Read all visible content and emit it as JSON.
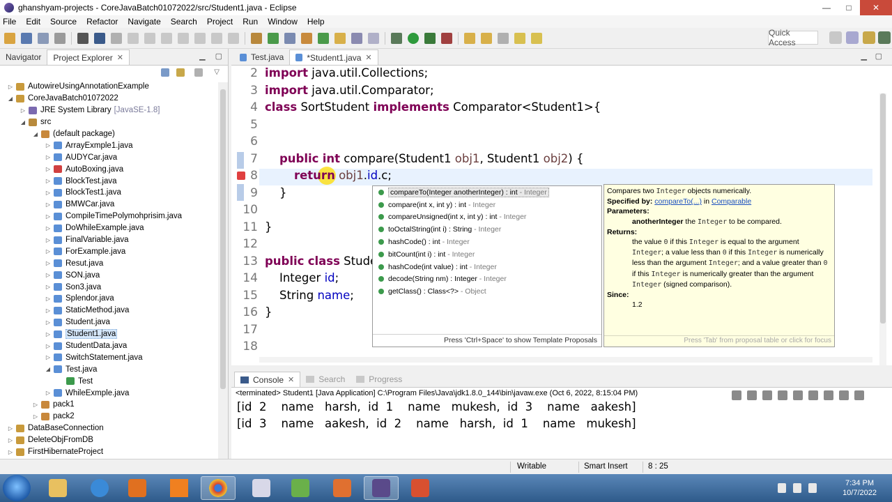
{
  "window": {
    "title": "ghanshyam-projects - CoreJavaBatch01072022/src/Student1.java - Eclipse",
    "controls": [
      "—",
      "□",
      "✕"
    ]
  },
  "menu": [
    "File",
    "Edit",
    "Source",
    "Refactor",
    "Navigate",
    "Search",
    "Project",
    "Run",
    "Window",
    "Help"
  ],
  "toolbar": {
    "quick_access": "Quick Access"
  },
  "left_tabs": [
    {
      "label": "Navigator",
      "close": ""
    },
    {
      "label": "Project Explorer",
      "close": "✕"
    }
  ],
  "tree": [
    {
      "indent": 0,
      "toggle": "▷",
      "icon": "proj",
      "label": "AutowireUsingAnnotationExample",
      "dim": ""
    },
    {
      "indent": 0,
      "toggle": "◢",
      "icon": "proj",
      "label": "CoreJavaBatch01072022",
      "dim": ""
    },
    {
      "indent": 1,
      "toggle": "▷",
      "icon": "lib",
      "label": "JRE System Library",
      "dim": "[JavaSE-1.8]"
    },
    {
      "indent": 1,
      "toggle": "◢",
      "icon": "src",
      "label": "src",
      "dim": ""
    },
    {
      "indent": 2,
      "toggle": "◢",
      "icon": "pkg",
      "label": "(default package)",
      "dim": ""
    },
    {
      "indent": 3,
      "toggle": "▷",
      "icon": "java",
      "label": "ArrayExmple1.java",
      "dim": ""
    },
    {
      "indent": 3,
      "toggle": "▷",
      "icon": "java",
      "label": "AUDYCar.java",
      "dim": ""
    },
    {
      "indent": 3,
      "toggle": "▷",
      "icon": "err",
      "label": "AutoBoxing.java",
      "dim": ""
    },
    {
      "indent": 3,
      "toggle": "▷",
      "icon": "java",
      "label": "BlockTest.java",
      "dim": ""
    },
    {
      "indent": 3,
      "toggle": "▷",
      "icon": "java",
      "label": "BlockTest1.java",
      "dim": ""
    },
    {
      "indent": 3,
      "toggle": "▷",
      "icon": "java",
      "label": "BMWCar.java",
      "dim": ""
    },
    {
      "indent": 3,
      "toggle": "▷",
      "icon": "java",
      "label": "CompileTimePolymohprisim.java",
      "dim": ""
    },
    {
      "indent": 3,
      "toggle": "▷",
      "icon": "java",
      "label": "DoWhileExample.java",
      "dim": ""
    },
    {
      "indent": 3,
      "toggle": "▷",
      "icon": "java",
      "label": "FinalVariable.java",
      "dim": ""
    },
    {
      "indent": 3,
      "toggle": "▷",
      "icon": "java",
      "label": "ForExample.java",
      "dim": ""
    },
    {
      "indent": 3,
      "toggle": "▷",
      "icon": "java",
      "label": "Resut.java",
      "dim": ""
    },
    {
      "indent": 3,
      "toggle": "▷",
      "icon": "java",
      "label": "SON.java",
      "dim": ""
    },
    {
      "indent": 3,
      "toggle": "▷",
      "icon": "java",
      "label": "Son3.java",
      "dim": ""
    },
    {
      "indent": 3,
      "toggle": "▷",
      "icon": "java",
      "label": "Splendor.java",
      "dim": ""
    },
    {
      "indent": 3,
      "toggle": "▷",
      "icon": "java",
      "label": "StaticMethod.java",
      "dim": ""
    },
    {
      "indent": 3,
      "toggle": "▷",
      "icon": "java",
      "label": "Student.java",
      "dim": ""
    },
    {
      "indent": 3,
      "toggle": "▷",
      "icon": "java",
      "label": "Student1.java",
      "dim": "",
      "selected": true
    },
    {
      "indent": 3,
      "toggle": "▷",
      "icon": "java",
      "label": "StudentData.java",
      "dim": ""
    },
    {
      "indent": 3,
      "toggle": "▷",
      "icon": "java",
      "label": "SwitchStatement.java",
      "dim": ""
    },
    {
      "indent": 3,
      "toggle": "◢",
      "icon": "java",
      "label": "Test.java",
      "dim": ""
    },
    {
      "indent": 4,
      "toggle": "",
      "icon": "cls",
      "label": "Test",
      "dim": ""
    },
    {
      "indent": 3,
      "toggle": "▷",
      "icon": "java",
      "label": "WhileExmple.java",
      "dim": ""
    },
    {
      "indent": 2,
      "toggle": "▷",
      "icon": "pkg",
      "label": "pack1",
      "dim": ""
    },
    {
      "indent": 2,
      "toggle": "▷",
      "icon": "pkg",
      "label": "pack2",
      "dim": ""
    },
    {
      "indent": 0,
      "toggle": "▷",
      "icon": "proj",
      "label": "DataBaseConnection",
      "dim": ""
    },
    {
      "indent": 0,
      "toggle": "▷",
      "icon": "proj",
      "label": "DeleteObjFromDB",
      "dim": ""
    },
    {
      "indent": 0,
      "toggle": "▷",
      "icon": "proj",
      "label": "FirstHibernateProject",
      "dim": ""
    }
  ],
  "editor_tabs": [
    {
      "label": "Test.java",
      "close": ""
    },
    {
      "label": "*Student1.java",
      "close": "✕"
    }
  ],
  "code_lines": [
    {
      "n": "2",
      "html": "<span class=\"kw\">import</span> java.util.Collections;"
    },
    {
      "n": "3",
      "html": "<span class=\"kw\">import</span> java.util.Comparator;"
    },
    {
      "n": "4",
      "html": "<span class=\"kw\">class</span> SortStudent <span class=\"kw\">implements</span> Comparator&lt;Student1&gt;{"
    },
    {
      "n": "5",
      "html": ""
    },
    {
      "n": "6",
      "html": ""
    },
    {
      "n": "7",
      "html": "    <span class=\"kw\">public</span> <span class=\"kw\">int</span> compare(Student1 <span class=\"par\">obj1</span>, Student1 <span class=\"par\">obj2</span>) {"
    },
    {
      "n": "8",
      "html": "        <span class=\"kw\">return</span> <span class=\"par\">obj1</span>.<span class=\"fld\">id</span>.c;"
    },
    {
      "n": "9",
      "html": "    }"
    },
    {
      "n": "10",
      "html": ""
    },
    {
      "n": "11",
      "html": "}"
    },
    {
      "n": "12",
      "html": ""
    },
    {
      "n": "13",
      "html": "<span class=\"kw\">public</span> <span class=\"kw\">class</span> Studen"
    },
    {
      "n": "14",
      "html": "    Integer <span class=\"fld\">id</span>;"
    },
    {
      "n": "15",
      "html": "    String <span class=\"fld\">name</span>;"
    },
    {
      "n": "16",
      "html": "}"
    },
    {
      "n": "17",
      "html": ""
    },
    {
      "n": "18",
      "html": ""
    }
  ],
  "proposals": [
    {
      "main": "compareTo(Integer anotherInteger) : int",
      "dim": " - Integer",
      "selected": true
    },
    {
      "main": "compare(int x, int y) : int",
      "dim": " - Integer"
    },
    {
      "main": "compareUnsigned(int x, int y) : int",
      "dim": " - Integer"
    },
    {
      "main": "toOctalString(int i) : String",
      "dim": " - Integer"
    },
    {
      "main": "hashCode() : int",
      "dim": " - Integer"
    },
    {
      "main": "bitCount(int i) : int",
      "dim": " - Integer"
    },
    {
      "main": "hashCode(int value) : int",
      "dim": " - Integer"
    },
    {
      "main": "decode(String nm) : Integer",
      "dim": " - Integer"
    },
    {
      "main": "getClass() : Class<?>",
      "dim": " - Object"
    }
  ],
  "assist_footer": "Press 'Ctrl+Space' to show Template Proposals",
  "doc": {
    "summary_pre": "Compares two ",
    "summary_mono": "Integer",
    "summary_post": " objects numerically.",
    "specified_label": "Specified by:",
    "specified_link": "compareTo(...)",
    "specified_in": " in ",
    "specified_iface": "Comparable",
    "params_label": "Parameters:",
    "param_name": "anotherInteger",
    "param_pre": " the ",
    "param_mono": "Integer",
    "param_post": " to be compared.",
    "returns_label": "Returns:",
    "since_label": "Since:",
    "since_val": "1.2",
    "footer": "Press 'Tab' from proposal table or click for focus"
  },
  "returns_html": "the value <span class=\"mono\">0</span> if this <span class=\"mono\">Integer</span> is equal to the argument <span class=\"mono\">Integer</span>; a value less than <span class=\"mono\">0</span> if this <span class=\"mono\">Integer</span> is numerically less than the argument <span class=\"mono\">Integer</span>; and a value greater than <span class=\"mono\">0</span> if this <span class=\"mono\">Integer</span> is numerically greater than the argument <span class=\"mono\">Integer</span> (signed comparison).",
  "console_tabs": [
    {
      "label": "Console",
      "close": "✕"
    },
    {
      "label": "Search",
      "close": ""
    },
    {
      "label": "Progress",
      "close": ""
    }
  ],
  "console": {
    "terminated": "<terminated> Student1 [Java Application] C:\\Program Files\\Java\\jdk1.8.0_144\\bin\\javaw.exe (Oct 6, 2022, 8:15:04 PM)",
    "lines": [
      "[id  2    name   harsh,  id  1    name   mukesh,  id  3    name   aakesh]",
      "[id  3    name   aakesh,  id  2    name   harsh,  id  1    name   mukesh]"
    ]
  },
  "status": {
    "writable": "Writable",
    "insert": "Smart Insert",
    "position": "8 : 25"
  },
  "clock": {
    "time": "7:34 PM",
    "date": "10/7/2022"
  }
}
